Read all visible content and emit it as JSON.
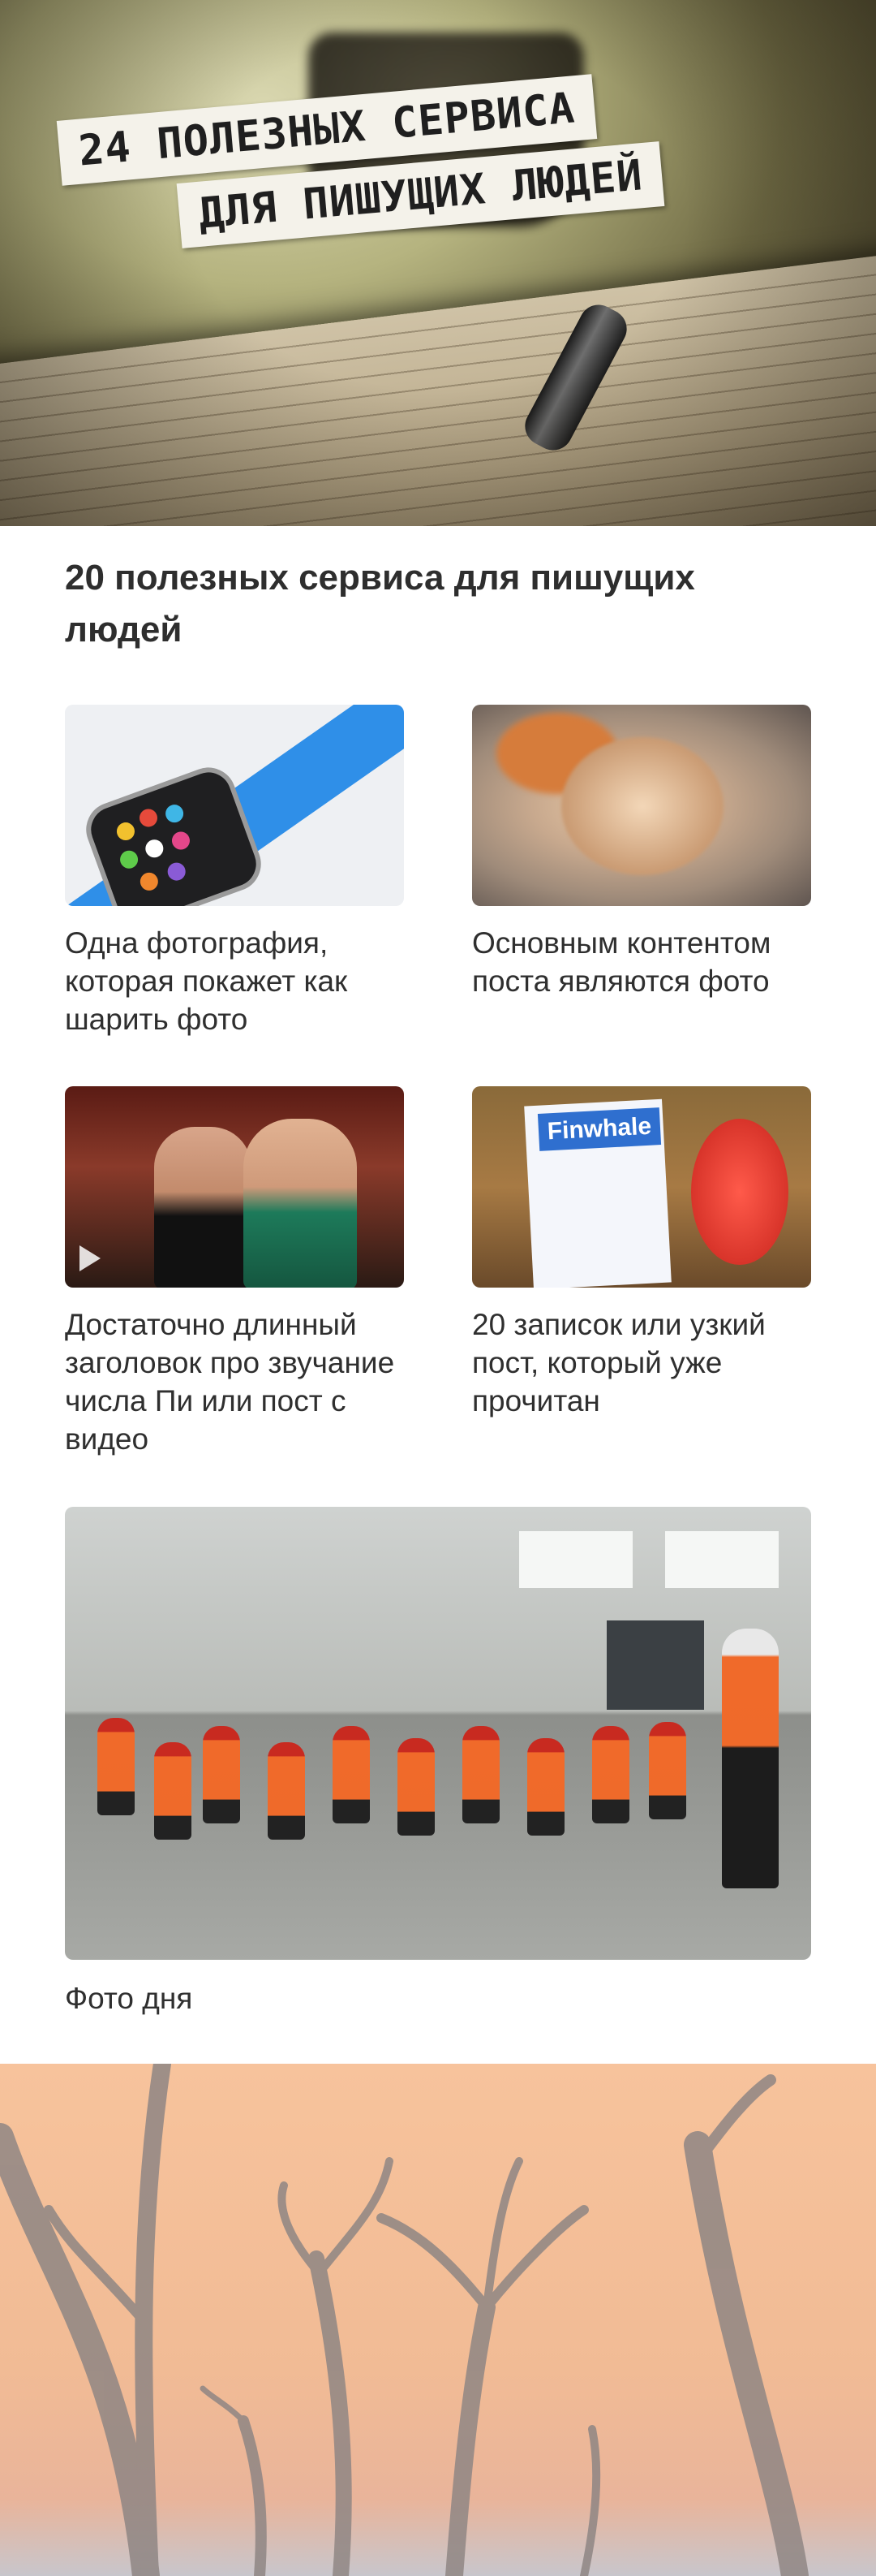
{
  "hero": {
    "line1": "24 ПОЛЕЗНЫХ СЕРВИСА",
    "line2": "ДЛЯ ПИШУЩИХ ЛЮДЕЙ"
  },
  "headline": "20 полезных сервиса для пишущих людей",
  "cards": [
    {
      "caption": "Одна фотография, которая покажет как шарить фото"
    },
    {
      "caption": "Основным контентом поста являются фото"
    },
    {
      "caption": "Достаточно длинный заголовок про звучание числа Пи или пост с видео"
    },
    {
      "caption": "20 записок или узкий пост, который уже прочитан",
      "brand": "Finwhale"
    }
  ],
  "photo_of_day": {
    "caption": "Фото дня"
  },
  "colors": {
    "desert_sky": "#f7c39c",
    "watch_band": "#2f8fe8"
  }
}
